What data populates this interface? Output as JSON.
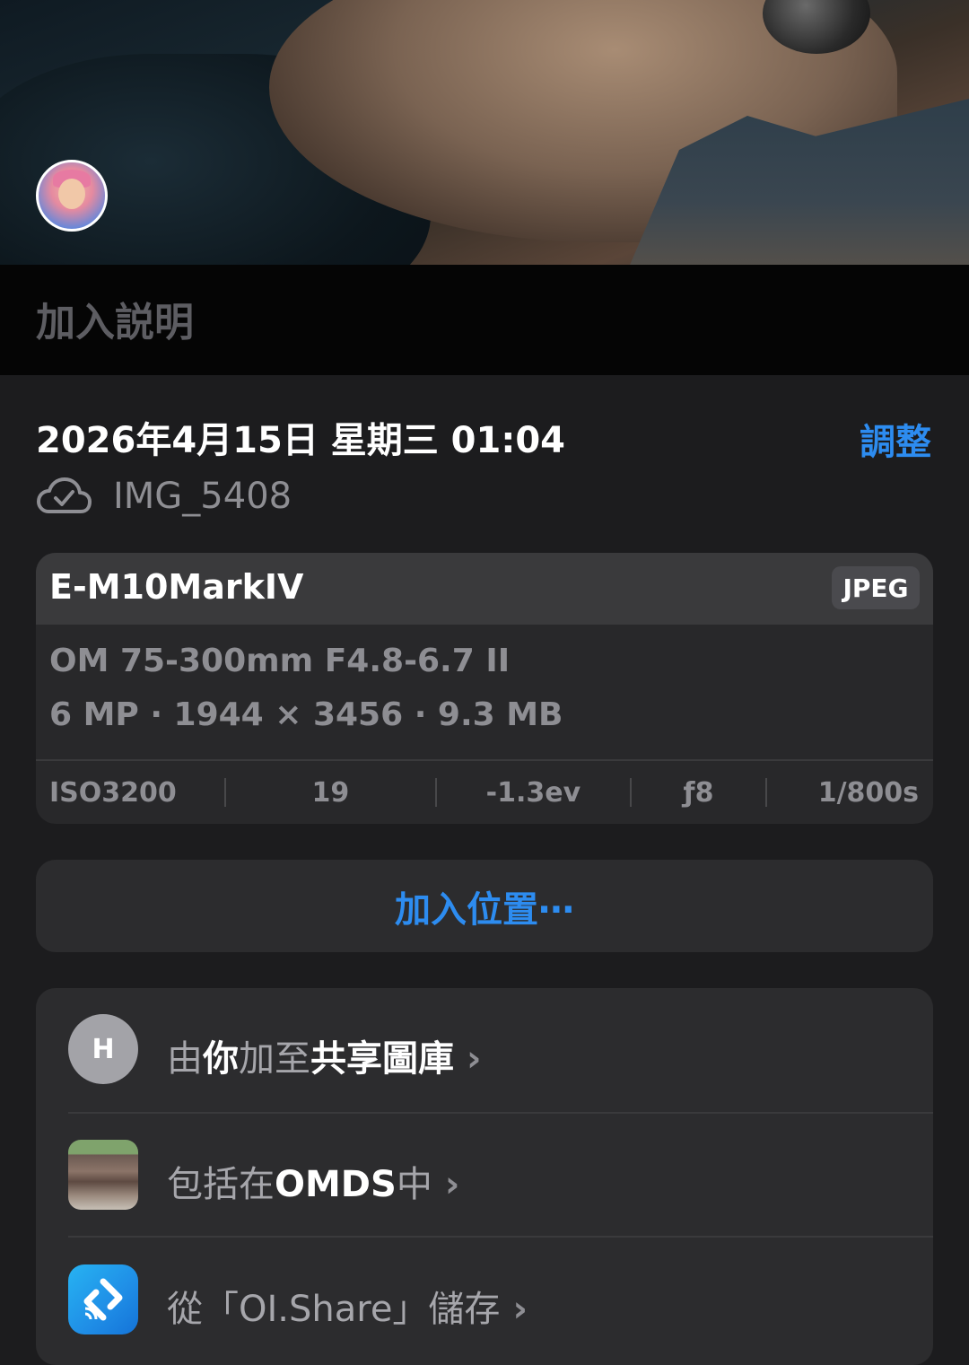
{
  "caption": {
    "placeholder": "加入説明"
  },
  "info": {
    "datetime": "2026年4月15日 星期三 01:04",
    "adjust_label": "調整",
    "filename": "IMG_5408"
  },
  "camera": {
    "model": "E-M10MarkIV",
    "format": "JPEG",
    "lens": "OM 75-300mm F4.8-6.7 II",
    "specs": "6 MP · 1944 × 3456 · 9.3 MB",
    "iso": "ISO3200",
    "focal": "19",
    "exposure_comp": "-1.3ev",
    "aperture": "ƒ8",
    "shutter": "1/800s"
  },
  "location": {
    "label": "加入位置⋯"
  },
  "rows": {
    "shared_initial": "H",
    "shared_pre": "由",
    "shared_you": "你",
    "shared_mid": "加至",
    "shared_lib": "共享圖庫",
    "album_pre": "包括在",
    "album_name": "OMDS",
    "album_post": "中",
    "app_label": "從「OI.Share」儲存",
    "chevron": "›"
  },
  "colors": {
    "accent": "#2d8cf0",
    "background": "#1c1c1e"
  }
}
